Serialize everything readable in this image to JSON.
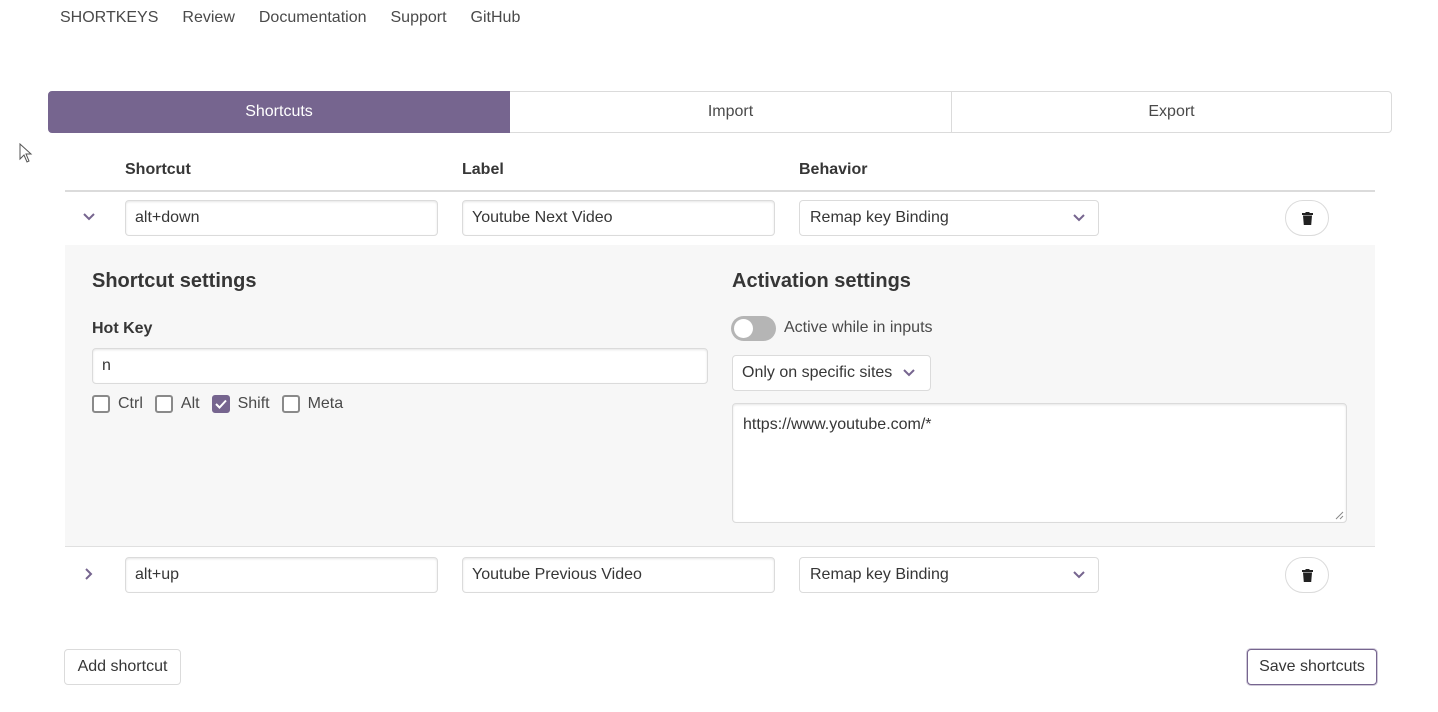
{
  "nav": [
    "SHORTKEYS",
    "Review",
    "Documentation",
    "Support",
    "GitHub"
  ],
  "tabs": [
    "Shortcuts",
    "Import",
    "Export"
  ],
  "table": {
    "headers": {
      "shortcut": "Shortcut",
      "label": "Label",
      "behavior": "Behavior"
    }
  },
  "rows": [
    {
      "shortcut": "alt+down",
      "label": "Youtube Next Video",
      "behavior": "Remap key Binding",
      "expanded": true
    },
    {
      "shortcut": "alt+up",
      "label": "Youtube Previous Video",
      "behavior": "Remap key Binding",
      "expanded": false
    }
  ],
  "details": {
    "shortcut_settings_title": "Shortcut settings",
    "hotkey_label": "Hot Key",
    "hotkey_value": "n",
    "modifiers": [
      {
        "label": "Ctrl",
        "checked": false
      },
      {
        "label": "Alt",
        "checked": false
      },
      {
        "label": "Shift",
        "checked": true
      },
      {
        "label": "Meta",
        "checked": false
      }
    ],
    "activation_title": "Activation settings",
    "active_inputs_label": "Active while in inputs",
    "active_inputs_on": false,
    "sites_mode": "Only on specific sites",
    "sites_list": "https://www.youtube.com/*"
  },
  "buttons": {
    "add": "Add shortcut",
    "save": "Save shortcuts"
  },
  "colors": {
    "accent": "#76658f",
    "border": "#dbdbdb",
    "panel": "#f7f7f7"
  }
}
